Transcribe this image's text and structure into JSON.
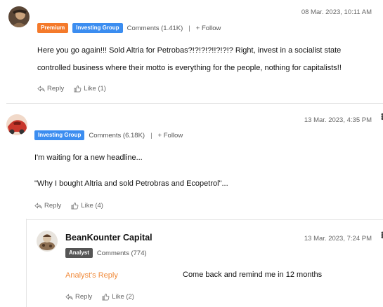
{
  "comments": [
    {
      "timestamp": "08 Mar. 2023, 10:11 AM",
      "badges": [
        "Premium",
        "Investing Group"
      ],
      "comments_link": "Comments (1.41K)",
      "separator": "|",
      "follow": "+ Follow",
      "lines": [
        "Here you go again!!! Sold Altria for Petrobas?!?!?!?!!?!?!? Right, invest in a socialist state",
        "controlled business where their motto is everything for the people, nothing for capitalists!!"
      ],
      "reply_label": "Reply",
      "like_label": "Like (1)"
    },
    {
      "timestamp": "13 Mar. 2023, 4:35 PM",
      "badges": [
        "Investing Group"
      ],
      "comments_link": "Comments (6.18K)",
      "separator": "|",
      "follow": "+ Follow",
      "lines": [
        "I'm waiting for a new headline...",
        "\"Why I bought Altria and sold Petrobras and Ecopetrol\"..."
      ],
      "reply_label": "Reply",
      "like_label": "Like (4)"
    },
    {
      "name": "BeanKounter Capital",
      "timestamp": "13 Mar. 2023, 7:24 PM",
      "badges": [
        "Analyst"
      ],
      "comments_link": "Comments (774)",
      "analyst_reply_label": "Analyst's Reply",
      "text": "Come back and remind me in 12 months",
      "reply_label": "Reply",
      "like_label": "Like (2)"
    }
  ],
  "colors": {
    "premium": "#f47a2b",
    "investing_group": "#3b8df0",
    "analyst": "#555555",
    "analyst_reply": "#f08a3a"
  },
  "icons": {
    "reply": "reply-arrow-icon",
    "like": "thumbs-up-icon",
    "menu": "more-vertical-icon"
  }
}
